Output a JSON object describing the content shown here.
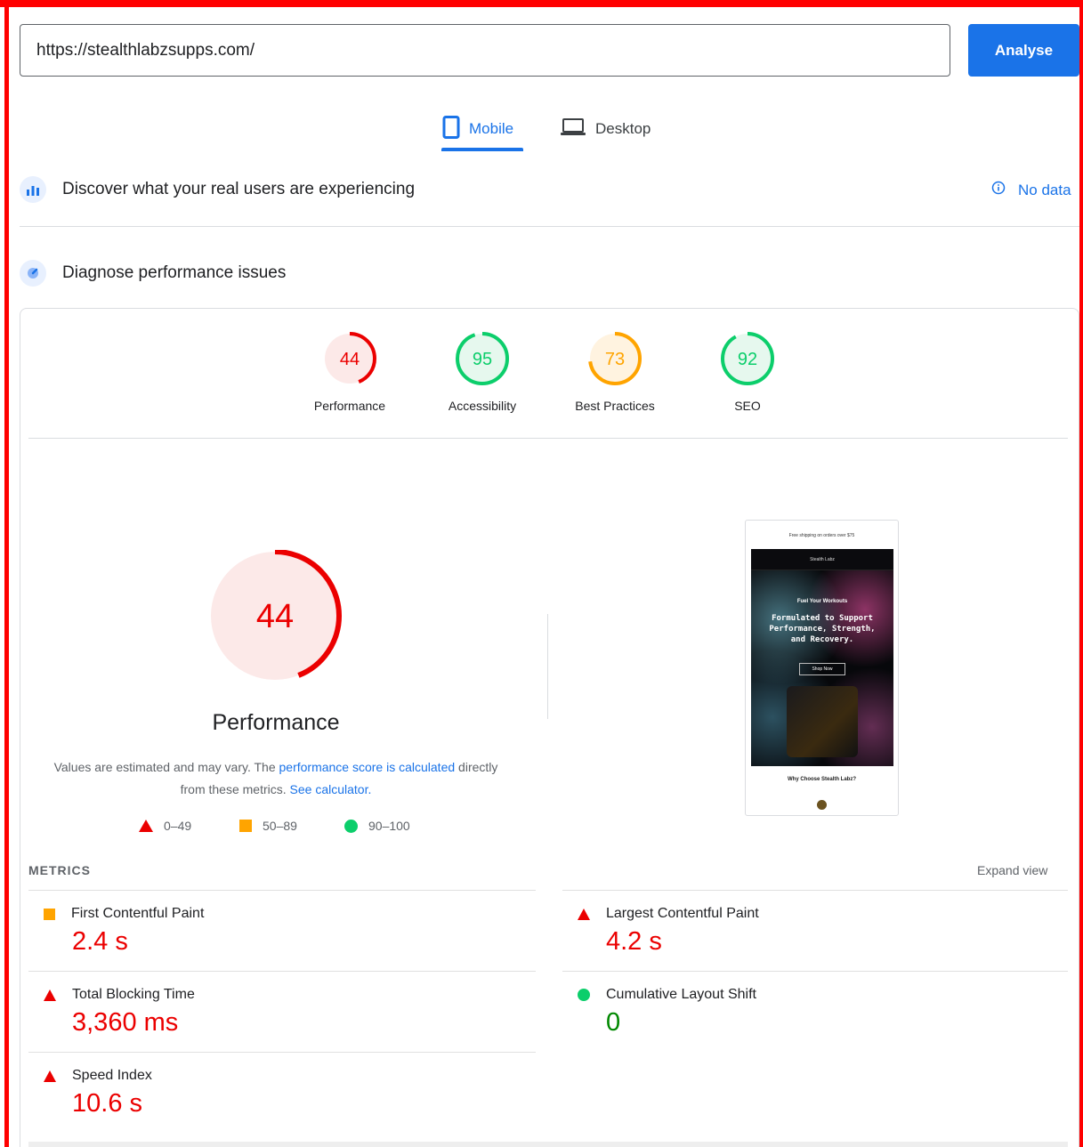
{
  "url_bar": {
    "value": "https://stealthlabzsupps.com/",
    "analyse_label": "Analyse"
  },
  "device_tabs": [
    {
      "label": "Mobile",
      "icon": "smartphone-icon",
      "active": true
    },
    {
      "label": "Desktop",
      "icon": "laptop-icon",
      "active": false
    }
  ],
  "sections": {
    "discover": {
      "label": "Discover what your real users are experiencing",
      "status": "No data",
      "icon": "bar-chart-icon"
    },
    "diagnose": {
      "label": "Diagnose performance issues",
      "icon": "gauge-icon"
    }
  },
  "categories": [
    {
      "label": "Performance",
      "score": "44",
      "color": "#eb0000",
      "bg": "#fce9e8",
      "fraction": 0.44
    },
    {
      "label": "Accessibility",
      "score": "95",
      "color": "#0cce6b",
      "bg": "#e6f8ee",
      "fraction": 0.95
    },
    {
      "label": "Best Practices",
      "score": "73",
      "color": "#ffa400",
      "bg": "#fff3e0",
      "fraction": 0.73
    },
    {
      "label": "SEO",
      "score": "92",
      "color": "#0cce6b",
      "bg": "#e6f8ee",
      "fraction": 0.92
    }
  ],
  "performance": {
    "score": "44",
    "fraction": 0.44,
    "title": "Performance",
    "desc_1": "Values are estimated and may vary. The ",
    "desc_link_1": "performance score is calculated",
    "desc_2": " directly from these metrics. ",
    "desc_link_2": "See calculator.",
    "legend": [
      "0–49",
      "50–89",
      "90–100"
    ]
  },
  "screenshot": {
    "topbar": "Free shipping on orders over $75",
    "brand": "Stealth Labz",
    "kicker": "Fuel Your Workouts",
    "headline": "Formulated to Support Performance, Strength, and Recovery.",
    "button": "Shop Now",
    "why": "Why Choose Stealth Labz?"
  },
  "metrics": {
    "header": "METRICS",
    "expand": "Expand view",
    "items": [
      {
        "label": "First Contentful Paint",
        "value": "2.4 s",
        "rating": "average"
      },
      {
        "label": "Largest Contentful Paint",
        "value": "4.2 s",
        "rating": "fail"
      },
      {
        "label": "Total Blocking Time",
        "value": "3,360 ms",
        "rating": "fail"
      },
      {
        "label": "Cumulative Layout Shift",
        "value": "0",
        "rating": "pass"
      },
      {
        "label": "Speed Index",
        "value": "10.6 s",
        "rating": "fail"
      }
    ]
  },
  "colors": {
    "accent": "#1a73e8",
    "fail": "#eb0000",
    "average": "#ffa400",
    "pass": "#0cce6b",
    "frame": "#ff0000"
  }
}
